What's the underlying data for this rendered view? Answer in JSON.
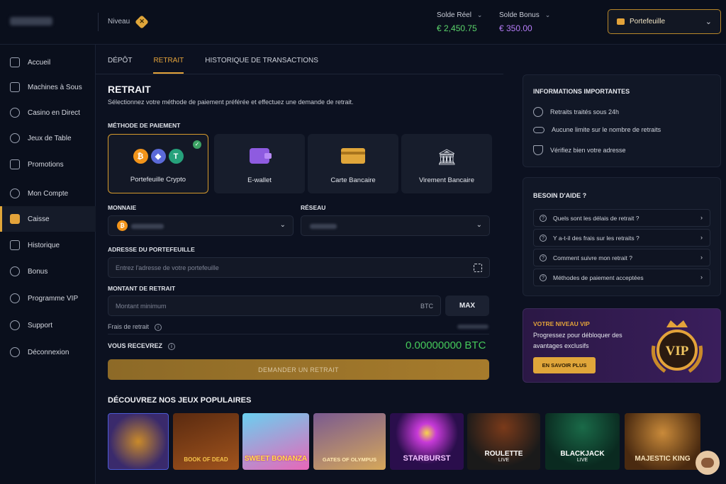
{
  "header": {
    "level_label": "Niveau",
    "level_icon": "level-badge-icon",
    "real_balance_label": "Solde Réel",
    "real_balance_value": "€ 2,450.75",
    "bonus_balance_label": "Solde Bonus",
    "bonus_balance_value": "€ 350.00",
    "wallet_label": "Portefeuille"
  },
  "sidebar": {
    "items": [
      {
        "label": "Accueil",
        "icon": "home-icon"
      },
      {
        "label": "Machines à Sous",
        "icon": "slots-icon"
      },
      {
        "label": "Casino en Direct",
        "icon": "live-casino-icon"
      },
      {
        "label": "Jeux de Table",
        "icon": "table-games-icon"
      },
      {
        "label": "Promotions",
        "icon": "gift-icon"
      },
      {
        "label": "Mon Compte",
        "icon": "user-icon"
      },
      {
        "label": "Caisse",
        "icon": "wallet-icon"
      },
      {
        "label": "Historique",
        "icon": "history-icon"
      },
      {
        "label": "Bonus",
        "icon": "bonus-icon"
      },
      {
        "label": "Programme VIP",
        "icon": "vip-icon"
      },
      {
        "label": "Support",
        "icon": "support-icon"
      },
      {
        "label": "Déconnexion",
        "icon": "logout-icon"
      }
    ],
    "active": "Caisse"
  },
  "tabs": [
    {
      "label": "DÉPÔT"
    },
    {
      "label": "RETRAIT"
    },
    {
      "label": "HISTORIQUE DE TRANSACTIONS"
    }
  ],
  "withdraw": {
    "title": "RETRAIT",
    "subtitle": "Sélectionnez votre méthode de paiement préférée et effectuez une demande de retrait.",
    "method_label": "MÉTHODE DE PAIEMENT",
    "methods": [
      {
        "label": "Portefeuille Crypto",
        "icon": "crypto-coins-icon"
      },
      {
        "label": "E-wallet",
        "icon": "e-wallet-icon"
      },
      {
        "label": "Carte Bancaire",
        "icon": "credit-card-icon"
      },
      {
        "label": "Virement Bancaire",
        "icon": "bank-icon"
      }
    ],
    "currency_label": "MONNAIE",
    "network_label": "RÉSEAU",
    "address_label": "ADRESSE DU PORTEFEUILLE",
    "address_placeholder": "Entrez l'adresse de votre portefeuille",
    "amount_label": "MONTANT DE RETRAIT",
    "amount_placeholder": "Montant minimum",
    "amount_unit": "BTC",
    "max_label": "MAX",
    "fee_label": "Frais de retrait",
    "receive_label": "VOUS RECEVREZ",
    "receive_value": "0.00000000 BTC",
    "submit_label": "DEMANDER UN RETRAIT"
  },
  "games": {
    "title": "DÉCOUVREZ NOS JEUX POPULAIRES",
    "items": [
      {
        "name": "",
        "sub": "",
        "color1": "#3a2a6c",
        "color2": "#6b4a1c"
      },
      {
        "name": "BOOK OF DEAD",
        "sub": "",
        "color1": "#5a2a10",
        "color2": "#a1541d"
      },
      {
        "name": "SWEET BONANZA",
        "sub": "",
        "color1": "#e866b8",
        "color2": "#6ad0f0"
      },
      {
        "name": "GATES OF OLYMPUS",
        "sub": "",
        "color1": "#7a5a90",
        "color2": "#d6a85a"
      },
      {
        "name": "STARBURST",
        "sub": "",
        "color1": "#2a0e4c",
        "color2": "#8a2ab6"
      },
      {
        "name": "ROULETTE",
        "sub": "LIVE",
        "color1": "#5a1a14",
        "color2": "#1a1a1a"
      },
      {
        "name": "BLACKJACK",
        "sub": "LIVE",
        "color1": "#0f4a32",
        "color2": "#0a2a20"
      },
      {
        "name": "MAJESTIC KING",
        "sub": "",
        "color1": "#4a2a10",
        "color2": "#a25a1e"
      }
    ]
  },
  "info": {
    "title": "INFORMATIONS IMPORTANTES",
    "items": [
      {
        "label": "Retraits traités sous 24h",
        "icon": "clock-icon"
      },
      {
        "label": "Aucune limite sur le nombre de retraits",
        "icon": "infinity-icon"
      },
      {
        "label": "Vérifiez bien votre adresse",
        "icon": "shield-icon"
      }
    ]
  },
  "help": {
    "title": "BESOIN D'AIDE ?",
    "questions": [
      "Quels sont les délais de retrait ?",
      "Y a-t-il des frais sur les retraits ?",
      "Comment suivre mon retrait ?",
      "Méthodes de paiement acceptées"
    ]
  },
  "vip": {
    "title": "VOTRE NIVEAU VIP",
    "description": "Progressez pour débloquer des avantages exclusifs",
    "button": "EN SAVOIR PLUS",
    "badge_text": "VIP"
  },
  "colors": {
    "accent": "#e3a33a",
    "real_balance": "#5bd46b",
    "bonus_balance": "#b57cf7",
    "receive": "#45c95a"
  }
}
